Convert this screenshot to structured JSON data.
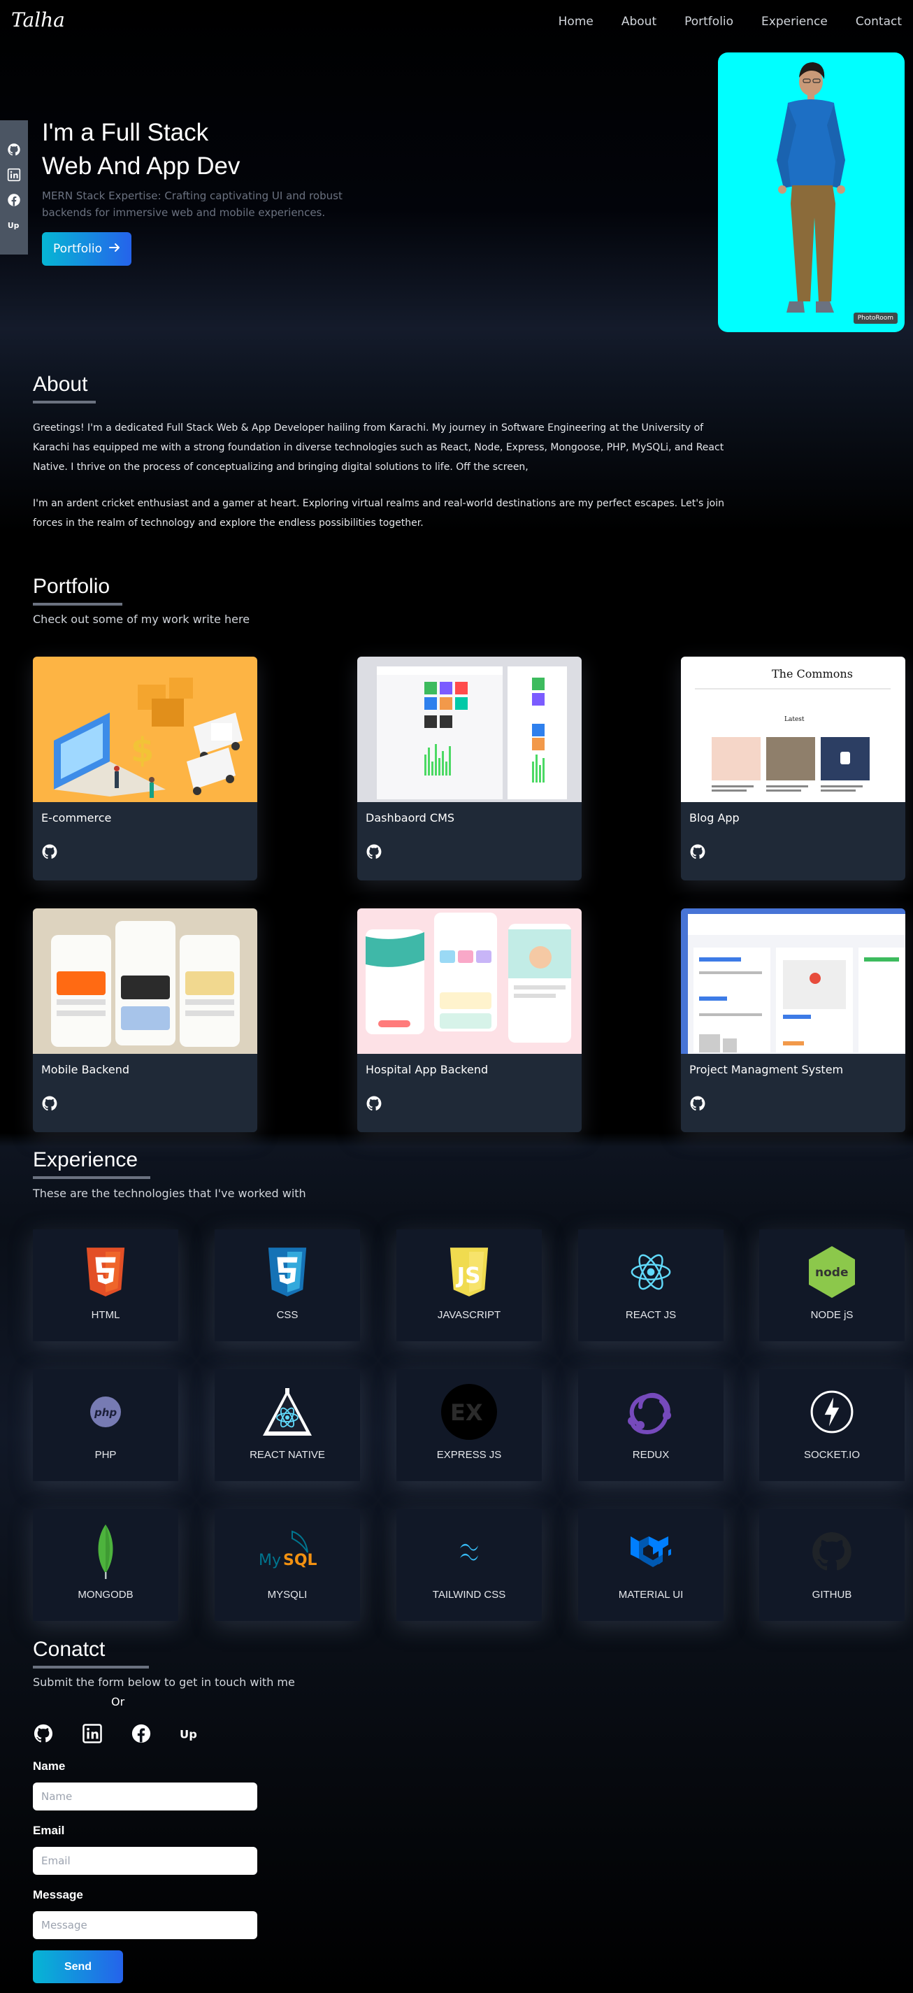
{
  "nav": {
    "logo": "Talha",
    "links": [
      "Home",
      "About",
      "Portfolio",
      "Experience",
      "Contact"
    ]
  },
  "side_social": [
    "github-icon",
    "linkedin-icon",
    "facebook-icon",
    "upwork-icon"
  ],
  "hero": {
    "title_line1": "I'm a Full Stack",
    "title_line2": "Web And App Dev",
    "subtitle": "MERN Stack Expertise: Crafting captivating UI and robust backends for immersive web and mobile experiences.",
    "button_label": "Portfolio",
    "photo_badge": "PhotoRoom",
    "photo_bg": "#00ffff"
  },
  "about": {
    "title": "About",
    "paragraph1": "Greetings! I'm a dedicated Full Stack Web & App Developer hailing from Karachi. My journey in Software Engineering at the University of Karachi has equipped me with a strong foundation in diverse technologies such as React, Node, Express, Mongoose, PHP, MySQLi, and React Native. I thrive on the process of conceptualizing and bringing digital solutions to life. Off the screen,",
    "paragraph2": "I'm an ardent cricket enthusiast and a gamer at heart. Exploring virtual realms and real-world destinations are my perfect escapes. Let's join forces in the realm of technology and explore the endless possibilities together."
  },
  "portfolio": {
    "title": "Portfolio",
    "subtitle": "Check out some of my work write here",
    "cards": [
      {
        "title": "E-commerce"
      },
      {
        "title": "Dashbaord CMS"
      },
      {
        "title": "Blog App"
      },
      {
        "title": "Mobile Backend"
      },
      {
        "title": "Hospital App Backend"
      },
      {
        "title": "Project Managment System"
      }
    ],
    "blog_thumb_heading": "The Commons",
    "blog_thumb_sub": "Latest"
  },
  "experience": {
    "title": "Experience",
    "subtitle": "These are the technologies that I've worked with",
    "skills": [
      {
        "name": "HTML",
        "icon": "html5-icon",
        "color": "#e34f26"
      },
      {
        "name": "CSS",
        "icon": "css3-icon",
        "color": "#1572b6"
      },
      {
        "name": "JAVASCRIPT",
        "icon": "javascript-icon",
        "color": "#f0db4f"
      },
      {
        "name": "REACT JS",
        "icon": "react-icon",
        "color": "#61dafb"
      },
      {
        "name": "NODE jS",
        "icon": "nodejs-icon",
        "color": "#8cc84b"
      },
      {
        "name": "PHP",
        "icon": "php-icon",
        "color": "#777bb3"
      },
      {
        "name": "REACT NATIVE",
        "icon": "react-native-icon",
        "color": "#61dafb"
      },
      {
        "name": "EXPRESS JS",
        "icon": "express-icon",
        "color": "#000000"
      },
      {
        "name": "REDUX",
        "icon": "redux-icon",
        "color": "#764abc"
      },
      {
        "name": "SOCKET.IO",
        "icon": "socketio-icon",
        "color": "#ffffff"
      },
      {
        "name": "MONGODB",
        "icon": "mongodb-icon",
        "color": "#4db33d"
      },
      {
        "name": "MYSQLI",
        "icon": "mysql-icon",
        "color": "#00758f"
      },
      {
        "name": "TAILWIND CSS",
        "icon": "tailwind-icon",
        "color": "#38bdf8"
      },
      {
        "name": "MATERIAL UI",
        "icon": "material-ui-icon",
        "color": "#007fff"
      },
      {
        "name": "GITHUB",
        "icon": "github-icon",
        "color": "#1f2328"
      }
    ]
  },
  "contact": {
    "title": "Conatct",
    "subtitle": "Submit the form below to get in touch with me",
    "or_text": "Or",
    "icons": [
      "github-icon",
      "linkedin-icon",
      "facebook-icon",
      "upwork-icon"
    ],
    "name_label": "Name",
    "name_placeholder": "Name",
    "email_label": "Email",
    "email_placeholder": "Email",
    "message_label": "Message",
    "message_placeholder": "Message",
    "send_label": "Send"
  }
}
